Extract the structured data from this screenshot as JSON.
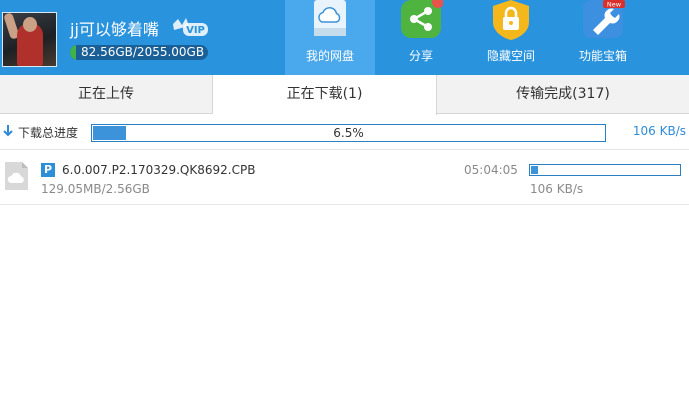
{
  "user": {
    "name": "jj可以够着嘴",
    "quota_text": "82.56GB/2055.00GB",
    "quota_used_fraction": 0.04,
    "vip_label": "VIP"
  },
  "nav": {
    "netdisk": {
      "label": "我的网盘",
      "icon": "cloud-disk-icon"
    },
    "share": {
      "label": "分享",
      "icon": "share-icon"
    },
    "hidden": {
      "label": "隐藏空间",
      "icon": "lock-icon"
    },
    "tools": {
      "label": "功能宝箱",
      "icon": "wrench-icon",
      "badge": "New"
    }
  },
  "tabs": {
    "uploading": "正在上传",
    "downloading": "正在下载(1)",
    "completed": "传输完成(317)"
  },
  "summary": {
    "label": "下载总进度",
    "percent_text": "6.5%",
    "progress": 0.065,
    "speed": "106 KB/s"
  },
  "downloads": [
    {
      "badge": "P",
      "name": "6.0.007.P2.170329.QK8692.CPB",
      "size": "129.05MB/2.56GB",
      "time_left": "05:04:05",
      "progress": 0.05,
      "speed": "106 KB/s"
    }
  ],
  "colors": {
    "header_bg": "#2a93de",
    "active_nav_bg": "#4aa8ec",
    "progress_fill": "#3d93d9",
    "quota_fill": "#3fb24a",
    "speed_text": "#2f8ad8"
  }
}
